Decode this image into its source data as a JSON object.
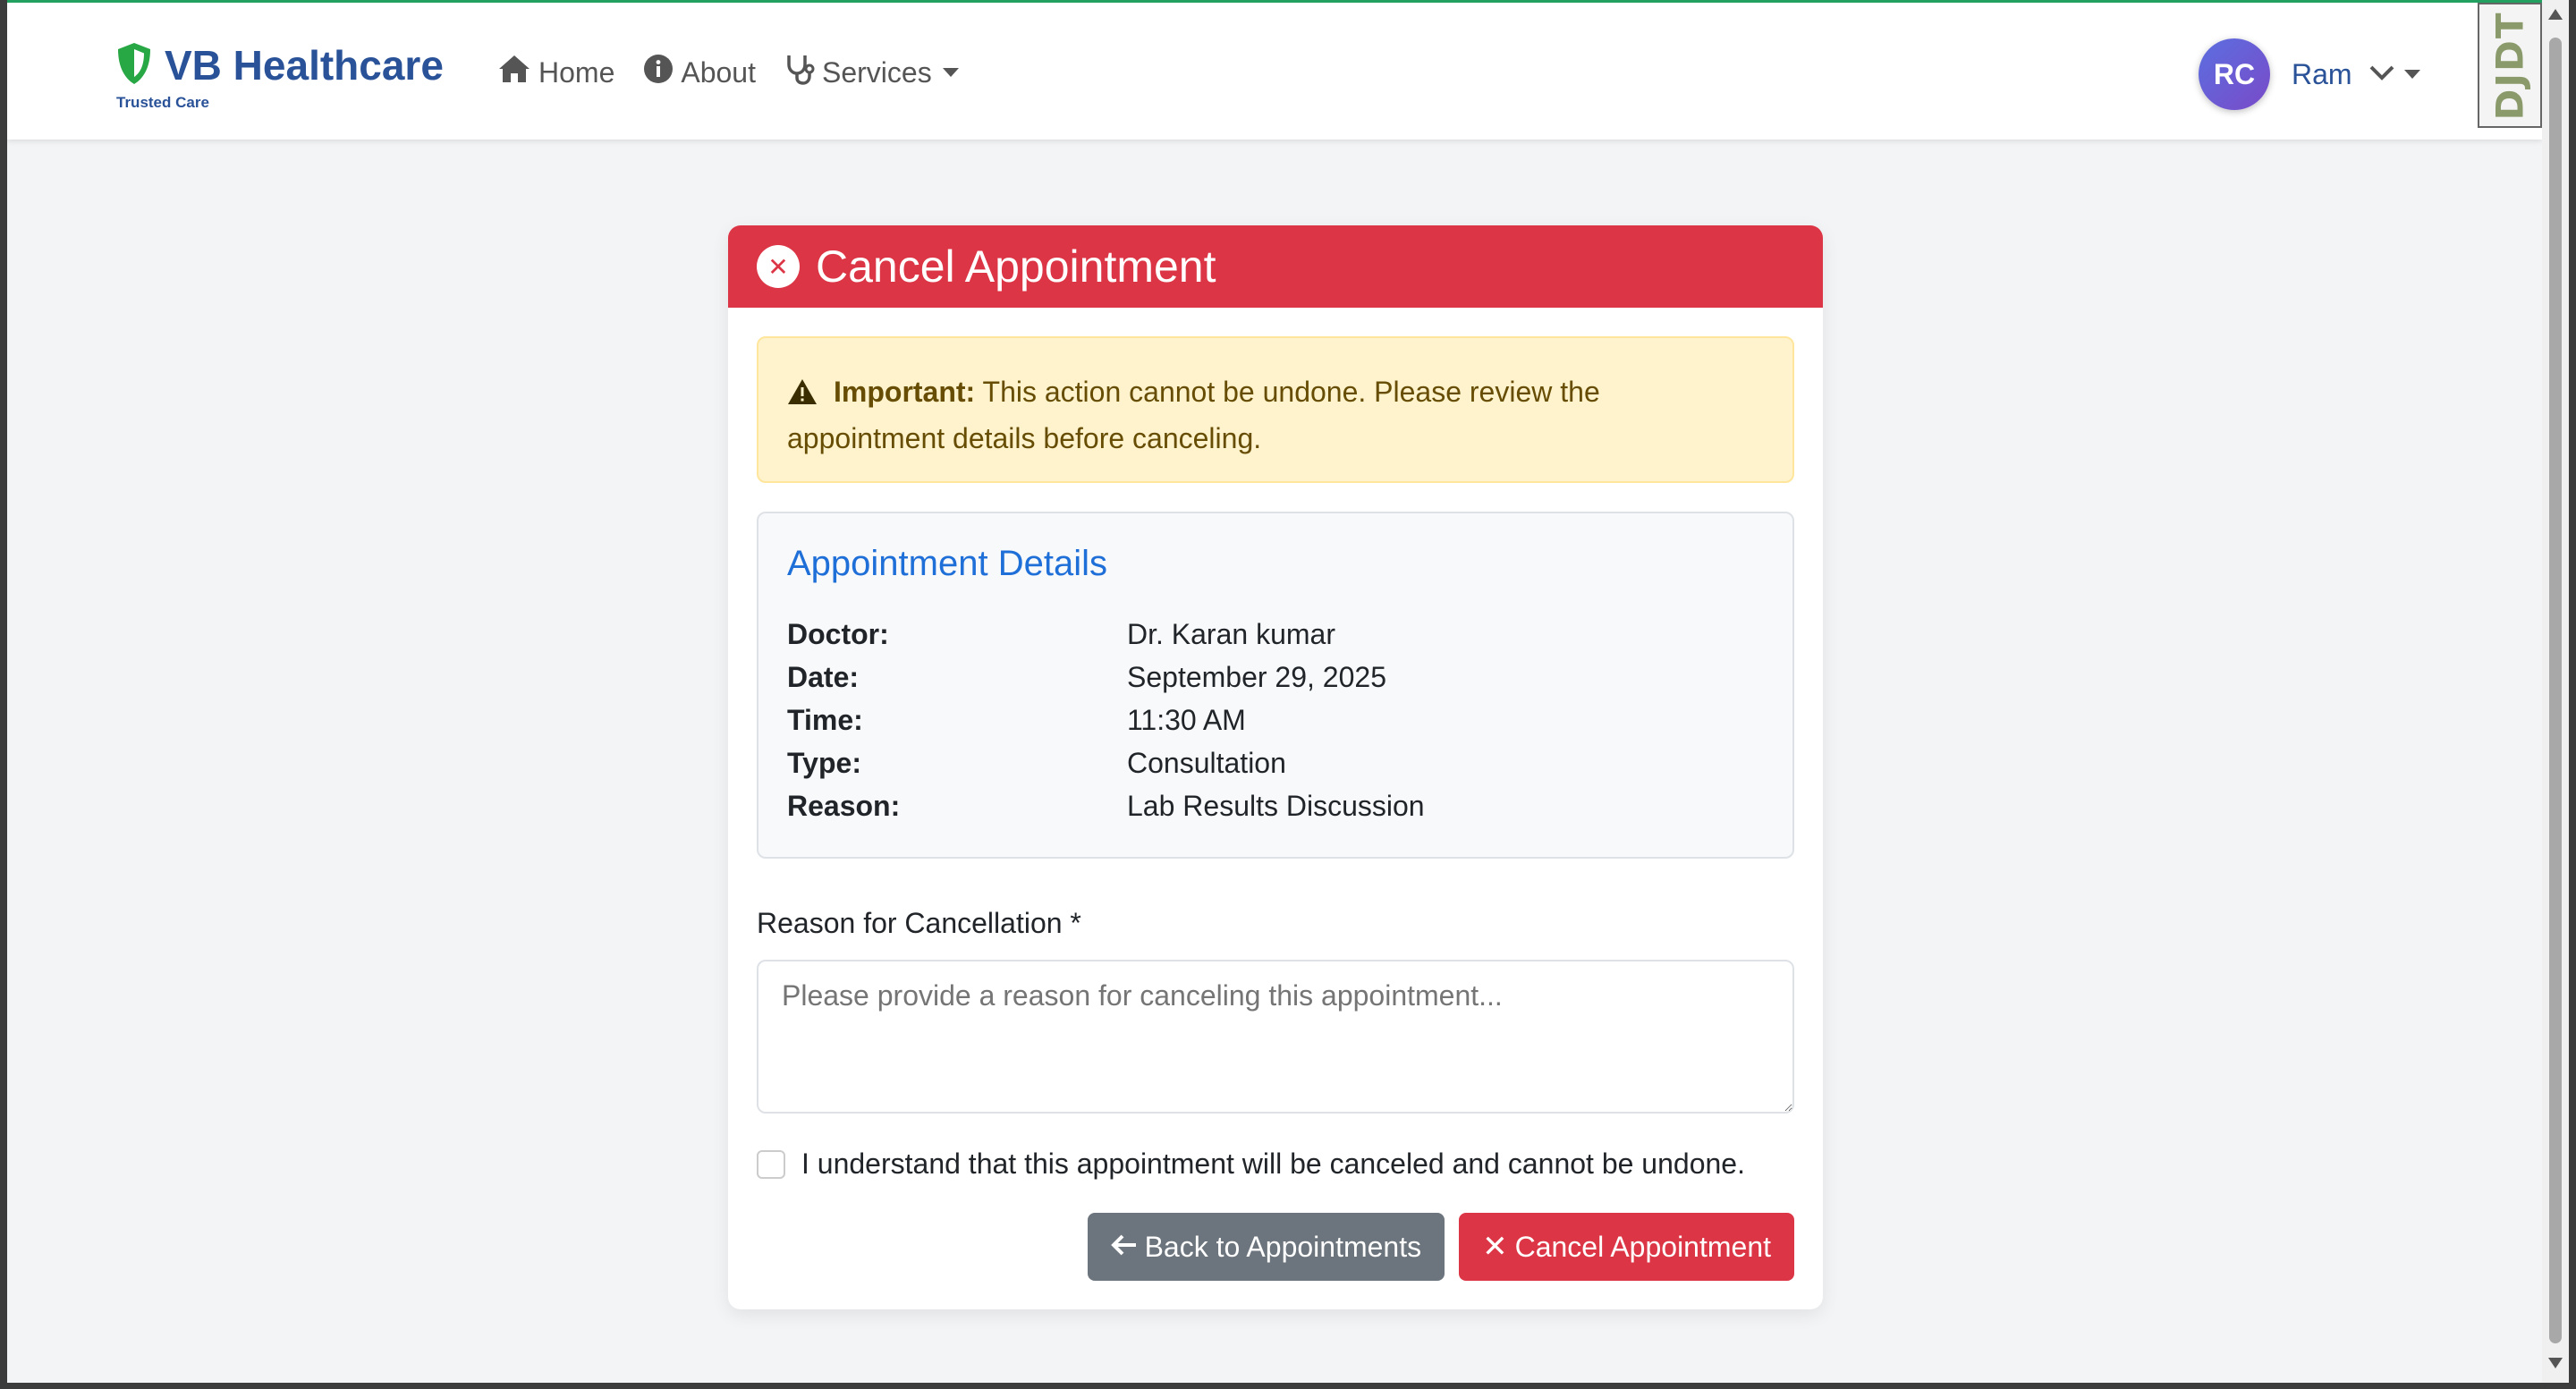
{
  "navbar": {
    "brand_title": "VB Healthcare",
    "brand_subtitle": "Trusted Care",
    "links": {
      "home": "Home",
      "about": "About",
      "services": "Services"
    },
    "user": {
      "initials": "RC",
      "name": "Ram"
    },
    "extension_badge": "DJDT"
  },
  "card": {
    "title": "Cancel Appointment",
    "alert": {
      "strong": "Important:",
      "text": " This action cannot be undone. Please review the appointment details before canceling."
    },
    "details": {
      "heading": "Appointment Details",
      "rows": [
        {
          "label": "Doctor:",
          "value": "Dr. Karan kumar"
        },
        {
          "label": "Date:",
          "value": "September 29, 2025"
        },
        {
          "label": "Time:",
          "value": "11:30 AM"
        },
        {
          "label": "Type:",
          "value": "Consultation"
        },
        {
          "label": "Reason:",
          "value": "Lab Results Discussion"
        }
      ]
    },
    "form": {
      "reason_label": "Reason for Cancellation *",
      "reason_placeholder": "Please provide a reason for canceling this appointment...",
      "reason_value": "",
      "confirm_label": "I understand that this appointment will be canceled and cannot be undone.",
      "confirm_checked": false
    },
    "buttons": {
      "back": "Back to Appointments",
      "cancel": "Cancel Appointment"
    }
  },
  "colors": {
    "brand": "#2a5298",
    "shield": "#28a745",
    "danger": "#dc3545",
    "secondary": "#6c757d",
    "warning_bg": "#fff3cd",
    "link_blue": "#1f6fd8"
  }
}
